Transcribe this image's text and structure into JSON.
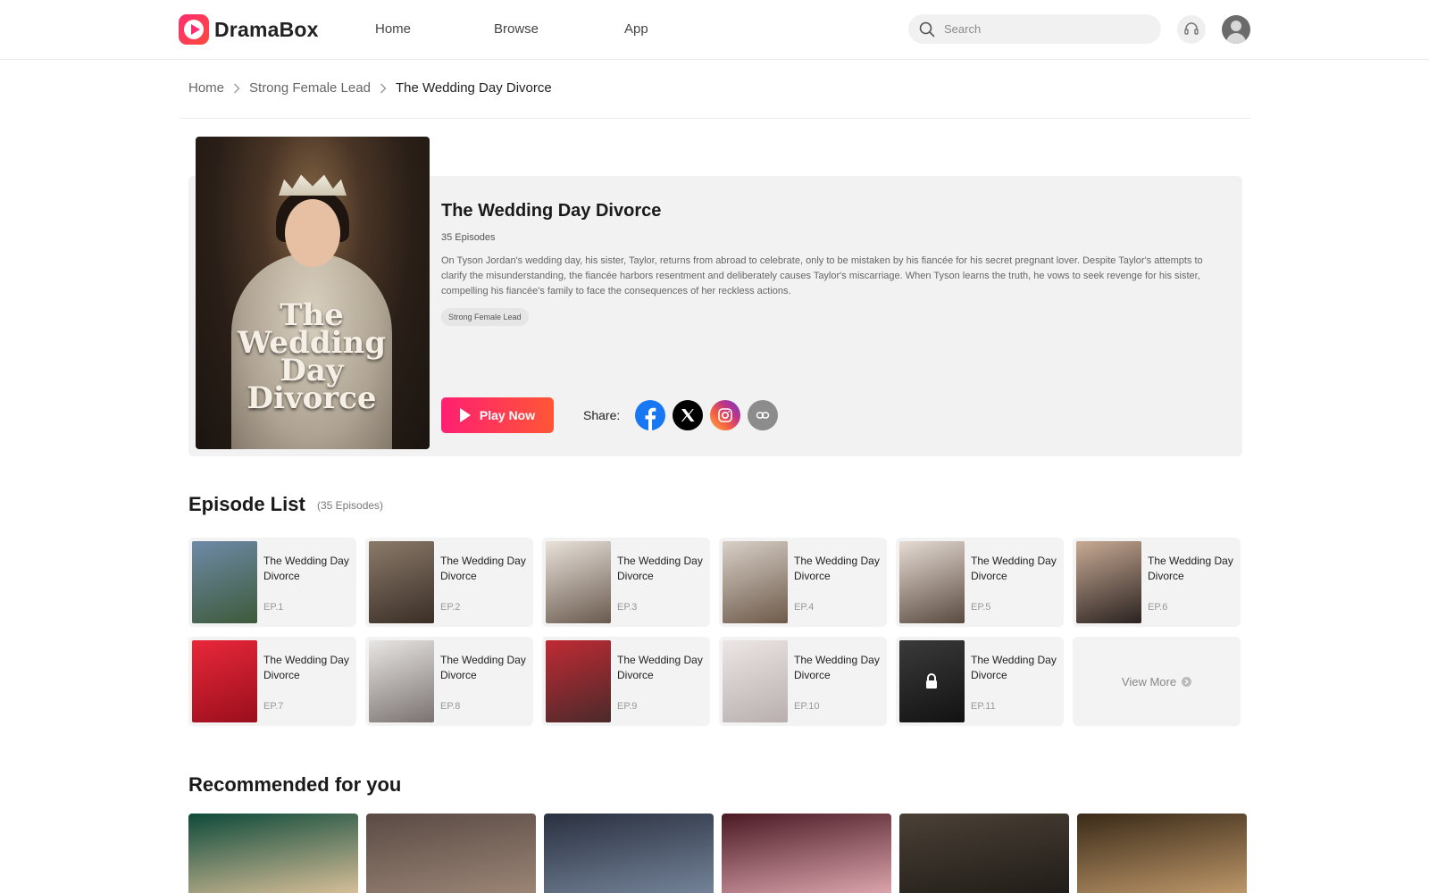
{
  "header": {
    "logo_text": "DramaBox",
    "nav": {
      "home": "Home",
      "browse": "Browse",
      "app": "App"
    },
    "search_placeholder": "Search"
  },
  "breadcrumb": {
    "home": "Home",
    "category": "Strong Female Lead",
    "current": "The Wedding Day Divorce"
  },
  "show": {
    "poster_title": "The Wedding Day Divorce",
    "title": "The Wedding Day Divorce",
    "episodes": "35 Episodes",
    "description": "On Tyson Jordan's wedding day, his sister, Taylor, returns from abroad to celebrate, only to be mistaken by his fiancée for his secret pregnant lover. Despite Taylor's attempts to clarify the misunderstanding, the fiancée harbors resentment and deliberately causes Taylor's miscarriage. When Tyson learns the truth, he vows to seek revenge for his sister, compelling his fiancée's family to face the consequences of her reckless actions.",
    "genre_tag": "Strong Female Lead",
    "play_label": "Play Now",
    "share_label": "Share:"
  },
  "episode_list": {
    "heading": "Episode List",
    "count": "(35 Episodes)",
    "view_more": "View More",
    "episodes": [
      {
        "title": "The Wedding Day Divorce",
        "ep": "EP.1",
        "locked": false,
        "colors": [
          "#6e8aa8",
          "#3d5a3a"
        ]
      },
      {
        "title": "The Wedding Day Divorce",
        "ep": "EP.2",
        "locked": false,
        "colors": [
          "#8a7a6a",
          "#3a2e26"
        ]
      },
      {
        "title": "The Wedding Day Divorce",
        "ep": "EP.3",
        "locked": false,
        "colors": [
          "#e8e2da",
          "#6a5a4e"
        ]
      },
      {
        "title": "The Wedding Day Divorce",
        "ep": "EP.4",
        "locked": false,
        "colors": [
          "#d8d0c8",
          "#6e5a4a"
        ]
      },
      {
        "title": "The Wedding Day Divorce",
        "ep": "EP.5",
        "locked": false,
        "colors": [
          "#e6dcd4",
          "#5a4a40"
        ]
      },
      {
        "title": "The Wedding Day Divorce",
        "ep": "EP.6",
        "locked": false,
        "colors": [
          "#c8aa94",
          "#2a2220"
        ]
      },
      {
        "title": "The Wedding Day Divorce",
        "ep": "EP.7",
        "locked": false,
        "colors": [
          "#e8283a",
          "#9a0e1c"
        ]
      },
      {
        "title": "The Wedding Day Divorce",
        "ep": "EP.8",
        "locked": false,
        "colors": [
          "#e8e6e4",
          "#7a7270"
        ]
      },
      {
        "title": "The Wedding Day Divorce",
        "ep": "EP.9",
        "locked": false,
        "colors": [
          "#c02a34",
          "#4a2a2a"
        ]
      },
      {
        "title": "The Wedding Day Divorce",
        "ep": "EP.10",
        "locked": false,
        "colors": [
          "#ece6e4",
          "#b8aeae"
        ]
      },
      {
        "title": "The Wedding Day Divorce",
        "ep": "EP.11",
        "locked": true,
        "colors": [
          "#3a3a3a",
          "#121212"
        ]
      }
    ]
  },
  "recommended": {
    "heading": "Recommended for you",
    "items": [
      {
        "colors": [
          "#0e4a3a",
          "#e8c8a0"
        ]
      },
      {
        "colors": [
          "#5a4a44",
          "#a08a7a"
        ]
      },
      {
        "colors": [
          "#2a3040",
          "#7a8aa0"
        ]
      },
      {
        "colors": [
          "#4a1a24",
          "#e8b0b8"
        ]
      },
      {
        "colors": [
          "#4a4036",
          "#1e1a16"
        ]
      },
      {
        "colors": [
          "#3a2a18",
          "#c8a070"
        ]
      }
    ]
  },
  "colors": {
    "accent_start": "#ff1f72",
    "accent_end": "#ff5636",
    "facebook": "#1877f2"
  }
}
